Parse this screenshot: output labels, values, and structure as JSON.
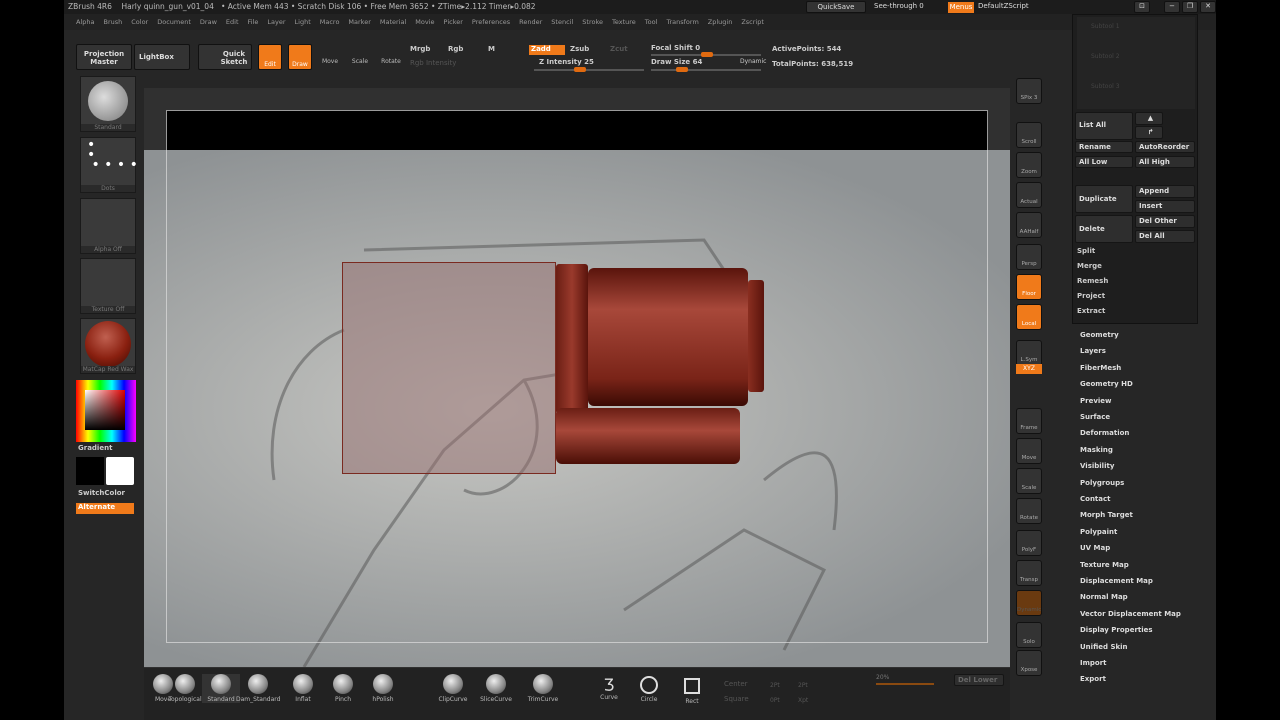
{
  "title": {
    "app": "ZBrush 4R6",
    "doc": "Harly quinn_gun_v01_04",
    "stats": "• Active Mem 443 • Scratch Disk 106 • Free Mem 3652 • ZTime▸2.112 Timer▸0.082"
  },
  "menus": [
    "Alpha",
    "Brush",
    "Color",
    "Document",
    "Draw",
    "Edit",
    "File",
    "Layer",
    "Light",
    "Macro",
    "Marker",
    "Material",
    "Movie",
    "Picker",
    "Preferences",
    "Render",
    "Stencil",
    "Stroke",
    "Texture",
    "Tool",
    "Transform",
    "Zplugin",
    "Zscript"
  ],
  "topright": {
    "quicksave": "QuickSave",
    "seethrough": "See-through  0",
    "menus": "Menus",
    "script": "DefaultZScript"
  },
  "toolbar": {
    "projection_master": "Projection Master",
    "lightbox": "LightBox",
    "quick_sketch": "Quick Sketch",
    "edit": "Edit",
    "draw": "Draw",
    "move": "Move",
    "scale": "Scale",
    "rotate": "Rotate",
    "mrgb": "Mrgb",
    "rgb": "Rgb",
    "m": "M",
    "rgb_intensity": "Rgb Intensity",
    "zadd": "Zadd",
    "zsub": "Zsub",
    "zcut": "Zcut",
    "z_intensity": "Z Intensity 25",
    "focal_shift": "Focal Shift 0",
    "draw_size": "Draw Size 64",
    "dynamic": "Dynamic",
    "active_points": "ActivePoints: 544",
    "total_points": "TotalPoints: 638,519"
  },
  "slider_values": {
    "z_intensity": 25,
    "focal_shift": 0,
    "draw_size": 64
  },
  "left": {
    "brush": "Standard",
    "stroke": "Dots",
    "alpha": "Alpha Off",
    "texture": "Texture Off",
    "material": "MatCap Red Wax",
    "gradient": "Gradient",
    "switch_color": "SwitchColor",
    "alternate": "Alternate"
  },
  "right_tools": [
    "SPix 3",
    "Scroll",
    "Zoom",
    "Actual",
    "AAHalf",
    "Persp",
    "Floor",
    "Local",
    "L.Sym",
    "XYZ",
    "Frame",
    "Move",
    "Scale",
    "Rotate",
    "PolyF",
    "Transp",
    "Dynamic",
    "Solo",
    "Xpose"
  ],
  "subtool": {
    "items": [
      "Subtool 1",
      "Subtool 2",
      "Subtool 3"
    ],
    "list_all": "List All",
    "rename": "Rename",
    "autoreorder": "AutoReorder",
    "all_low": "All Low",
    "all_high": "All High",
    "duplicate": "Duplicate",
    "append": "Append",
    "insert": "Insert",
    "delete": "Delete",
    "del_other": "Del Other",
    "del_all": "Del All",
    "split": "Split",
    "merge": "Merge",
    "remesh": "Remesh",
    "project": "Project",
    "extract": "Extract"
  },
  "subpalettes": [
    "Geometry",
    "Layers",
    "FiberMesh",
    "Geometry HD",
    "Preview",
    "Surface",
    "Deformation",
    "Masking",
    "Visibility",
    "Polygroups",
    "Contact",
    "Morph Target",
    "Polypaint",
    "UV Map",
    "Texture Map",
    "Displacement Map",
    "Normal Map",
    "Vector Displacement Map",
    "Display Properties",
    "Unified Skin",
    "Import",
    "Export"
  ],
  "bottom": {
    "brushes": [
      "Move",
      "Topological",
      "Standard",
      "Dam_Standard",
      "Inflat",
      "Pinch",
      "hPolish",
      "ClipCurve",
      "SliceCurve",
      "TrimCurve"
    ],
    "curve": "Curve",
    "circle": "Circle",
    "rect": "Rect",
    "center": "Center",
    "square": "Square",
    "v1": "2Pt",
    "v2": "2Pt",
    "v3": "0Pt",
    "v4": "Xpt",
    "pct": "20%",
    "del_lower": "Del Lower"
  },
  "colors": {
    "accent": "#f07a1a",
    "background": "#262626"
  }
}
